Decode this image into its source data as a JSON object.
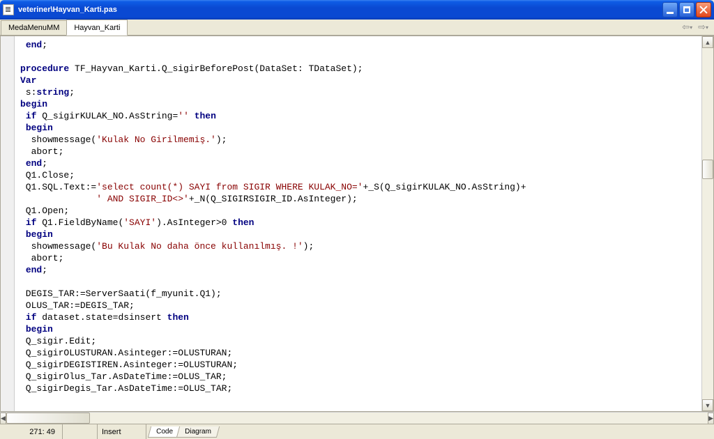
{
  "window": {
    "title": "veteriner\\Hayvan_Karti.pas"
  },
  "tabs": {
    "items": [
      {
        "label": "MedaMenuMM",
        "active": false
      },
      {
        "label": "Hayvan_Karti",
        "active": true
      }
    ]
  },
  "status": {
    "position": "271: 49",
    "modified": "",
    "mode": "Insert"
  },
  "bottom_tabs": {
    "items": [
      {
        "label": "Code",
        "active": true
      },
      {
        "label": "Diagram",
        "active": false
      }
    ]
  },
  "code": {
    "lines": [
      {
        "segs": [
          {
            "t": " "
          },
          {
            "t": "end",
            "c": "kw"
          },
          {
            "t": ";"
          }
        ]
      },
      {
        "segs": [
          {
            "t": ""
          }
        ]
      },
      {
        "segs": [
          {
            "t": "procedure",
            "c": "kw"
          },
          {
            "t": " TF_Hayvan_Karti.Q_sigirBeforePost(DataSet: TDataSet);"
          }
        ]
      },
      {
        "segs": [
          {
            "t": "Var",
            "c": "kw"
          }
        ]
      },
      {
        "segs": [
          {
            "t": " s:"
          },
          {
            "t": "string",
            "c": "kw"
          },
          {
            "t": ";"
          }
        ]
      },
      {
        "segs": [
          {
            "t": "begin",
            "c": "kw"
          }
        ]
      },
      {
        "segs": [
          {
            "t": " "
          },
          {
            "t": "if",
            "c": "kw"
          },
          {
            "t": " Q_sigirKULAK_NO.AsString="
          },
          {
            "t": "''",
            "c": "str"
          },
          {
            "t": " "
          },
          {
            "t": "then",
            "c": "kw"
          }
        ]
      },
      {
        "segs": [
          {
            "t": " "
          },
          {
            "t": "begin",
            "c": "kw"
          }
        ]
      },
      {
        "segs": [
          {
            "t": "  showmessage("
          },
          {
            "t": "'Kulak No Girilmemiş.'",
            "c": "str"
          },
          {
            "t": ");"
          }
        ]
      },
      {
        "segs": [
          {
            "t": "  abort;"
          }
        ]
      },
      {
        "segs": [
          {
            "t": " "
          },
          {
            "t": "end",
            "c": "kw"
          },
          {
            "t": ";"
          }
        ]
      },
      {
        "segs": [
          {
            "t": " Q1.Close;"
          }
        ]
      },
      {
        "segs": [
          {
            "t": " Q1.SQL.Text:="
          },
          {
            "t": "'select count(*) SAYI from SIGIR WHERE KULAK_NO='",
            "c": "str"
          },
          {
            "t": "+_S(Q_sigirKULAK_NO.AsString)+"
          }
        ]
      },
      {
        "segs": [
          {
            "t": "              "
          },
          {
            "t": "' AND SIGIR_ID<>'",
            "c": "str"
          },
          {
            "t": "+_N(Q_SIGIRSIGIR_ID.AsInteger);"
          }
        ]
      },
      {
        "segs": [
          {
            "t": " Q1.Open;"
          }
        ]
      },
      {
        "segs": [
          {
            "t": " "
          },
          {
            "t": "if",
            "c": "kw"
          },
          {
            "t": " Q1.FieldByName("
          },
          {
            "t": "'SAYI'",
            "c": "str"
          },
          {
            "t": ").AsInteger>0 "
          },
          {
            "t": "then",
            "c": "kw"
          }
        ]
      },
      {
        "segs": [
          {
            "t": " "
          },
          {
            "t": "begin",
            "c": "kw"
          }
        ]
      },
      {
        "segs": [
          {
            "t": "  showmessage("
          },
          {
            "t": "'Bu Kulak No daha önce kullanılmış. !'",
            "c": "str"
          },
          {
            "t": ");"
          }
        ]
      },
      {
        "segs": [
          {
            "t": "  abort;"
          }
        ]
      },
      {
        "segs": [
          {
            "t": " "
          },
          {
            "t": "end",
            "c": "kw"
          },
          {
            "t": ";"
          }
        ]
      },
      {
        "segs": [
          {
            "t": ""
          }
        ]
      },
      {
        "segs": [
          {
            "t": " DEGIS_TAR:=ServerSaati(f_myunit.Q1);"
          }
        ]
      },
      {
        "segs": [
          {
            "t": " OLUS_TAR:=DEGIS_TAR;"
          }
        ]
      },
      {
        "segs": [
          {
            "t": " "
          },
          {
            "t": "if",
            "c": "kw"
          },
          {
            "t": " dataset.state=dsinsert "
          },
          {
            "t": "then",
            "c": "kw"
          }
        ]
      },
      {
        "segs": [
          {
            "t": " "
          },
          {
            "t": "begin",
            "c": "kw"
          }
        ]
      },
      {
        "segs": [
          {
            "t": " Q_sigir.Edit;"
          }
        ]
      },
      {
        "segs": [
          {
            "t": " Q_sigirOLUSTURAN.Asinteger:=OLUSTURAN;"
          }
        ]
      },
      {
        "segs": [
          {
            "t": " Q_sigirDEGISTIREN.Asinteger:=OLUSTURAN;"
          }
        ]
      },
      {
        "segs": [
          {
            "t": " Q_sigirOlus_Tar.AsDateTime:=OLUS_TAR;"
          }
        ]
      },
      {
        "segs": [
          {
            "t": " Q_sigirDegis_Tar.AsDateTime:=OLUS_TAR;"
          }
        ]
      }
    ]
  }
}
